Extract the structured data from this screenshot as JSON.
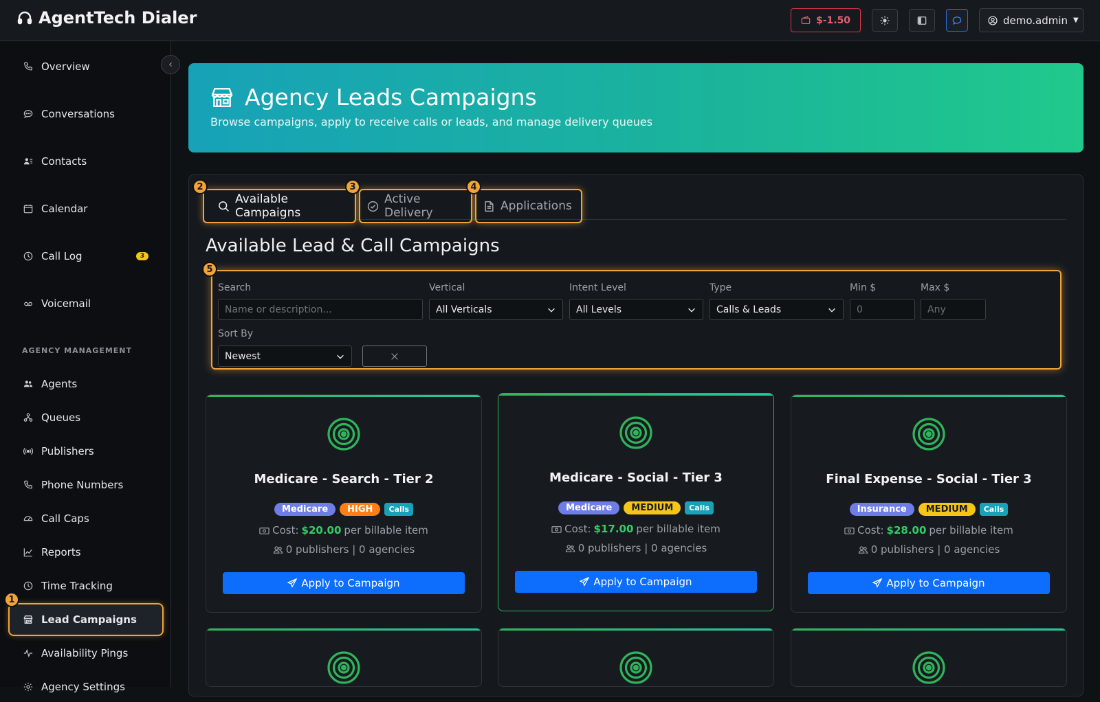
{
  "app": {
    "title": "AgentTech Dialer"
  },
  "header": {
    "balance": "$-1.50",
    "user": "demo.admin"
  },
  "sidebar": {
    "items": [
      {
        "label": "Overview"
      },
      {
        "label": "Conversations"
      },
      {
        "label": "Contacts"
      },
      {
        "label": "Calendar"
      },
      {
        "label": "Call Log",
        "badge": "3"
      },
      {
        "label": "Voicemail"
      }
    ],
    "section_label": "AGENCY MANAGEMENT",
    "agency_items": [
      {
        "label": "Agents"
      },
      {
        "label": "Queues"
      },
      {
        "label": "Publishers"
      },
      {
        "label": "Phone Numbers"
      },
      {
        "label": "Call Caps"
      },
      {
        "label": "Reports"
      },
      {
        "label": "Time Tracking"
      },
      {
        "label": "Lead Campaigns"
      },
      {
        "label": "Availability Pings"
      },
      {
        "label": "Agency Settings"
      }
    ]
  },
  "markers": [
    "1",
    "2",
    "3",
    "4",
    "5"
  ],
  "hero": {
    "title": "Agency Leads Campaigns",
    "subtitle": "Browse campaigns, apply to receive calls or leads, and manage delivery queues"
  },
  "tabs": [
    {
      "label": "Available Campaigns"
    },
    {
      "label": "Active Delivery"
    },
    {
      "label": "Applications"
    }
  ],
  "panel_title": "Available Lead & Call Campaigns",
  "filters": {
    "search_label": "Search",
    "search_placeholder": "Name or description...",
    "vertical_label": "Vertical",
    "vertical_value": "All Verticals",
    "intent_label": "Intent Level",
    "intent_value": "All Levels",
    "type_label": "Type",
    "type_value": "Calls & Leads",
    "min_label": "Min $",
    "min_placeholder": "0",
    "max_label": "Max $",
    "max_placeholder": "Any",
    "sort_label": "Sort By",
    "sort_value": "Newest"
  },
  "campaigns": [
    {
      "title": "Medicare - Search - Tier 2",
      "vertical": "Medicare",
      "intent": "HIGH",
      "type": "Calls",
      "cost_prefix": "Cost:",
      "cost": "$20.00",
      "cost_suffix": "per billable item",
      "reach": "0 publishers | 0 agencies",
      "action": "Apply to Campaign"
    },
    {
      "title": "Medicare - Social - Tier 3",
      "vertical": "Medicare",
      "intent": "MEDIUM",
      "type": "Calls",
      "cost_prefix": "Cost:",
      "cost": "$17.00",
      "cost_suffix": "per billable item",
      "reach": "0 publishers | 0 agencies",
      "action": "Apply to Campaign"
    },
    {
      "title": "Final Expense - Social - Tier 3",
      "vertical": "Insurance",
      "intent": "MEDIUM",
      "type": "Calls",
      "cost_prefix": "Cost:",
      "cost": "$28.00",
      "cost_suffix": "per billable item",
      "reach": "0 publishers | 0 agencies",
      "action": "Apply to Campaign"
    }
  ],
  "colors": {
    "accent": "#0d6efd",
    "highlight": "#f2a33a",
    "hero_start": "#17a2b8",
    "hero_end": "#20c98c",
    "success": "#2fd066"
  }
}
